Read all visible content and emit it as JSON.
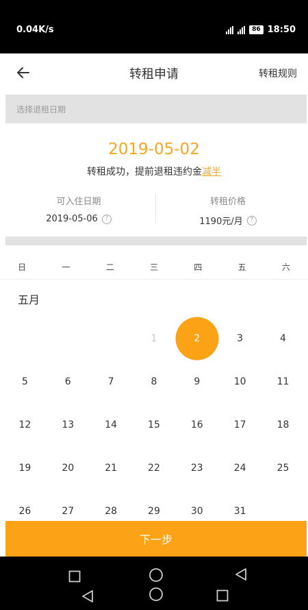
{
  "status_bar": {
    "speed": "0.04K/s",
    "battery": "86",
    "time": "18:50"
  },
  "header": {
    "title": "转租申请",
    "rules_link": "转租规则",
    "back_icon": "arrow-left-icon"
  },
  "select_bar": {
    "placeholder": "选择退租日期"
  },
  "summary": {
    "selected_date": "2019-05-02",
    "message_prefix": "转租成功，提前退租违约金",
    "message_highlight": "减半"
  },
  "info": {
    "move_in_label": "可入住日期",
    "move_in_value": "2019-05-06",
    "price_label": "转租价格",
    "price_value": "1190元/月"
  },
  "calendar": {
    "weekdays": [
      "日",
      "一",
      "二",
      "三",
      "四",
      "五",
      "六"
    ],
    "month": "五月",
    "rows": [
      [
        "",
        "",
        "",
        "1",
        "2",
        "3",
        "4"
      ],
      [
        "5",
        "6",
        "7",
        "8",
        "9",
        "10",
        "11"
      ],
      [
        "12",
        "13",
        "14",
        "15",
        "16",
        "17",
        "18"
      ],
      [
        "19",
        "20",
        "21",
        "22",
        "23",
        "24",
        "25"
      ],
      [
        "26",
        "27",
        "28",
        "29",
        "30",
        "31",
        ""
      ]
    ],
    "disabled_days": [
      "1"
    ],
    "selected_day": "2"
  },
  "next_button": {
    "label": "下一步"
  },
  "colors": {
    "accent": "#fca216",
    "date_text": "#f5a623"
  }
}
